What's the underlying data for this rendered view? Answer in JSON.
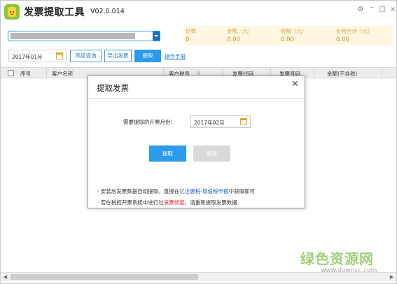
{
  "app": {
    "title": "发票提取工具",
    "version": "V02.0.014",
    "window_controls": [
      "gear-icon",
      "minimize-icon",
      "maximize-icon",
      "close-icon"
    ]
  },
  "toolbar": {
    "date_value": "2017年01月",
    "advanced_query_label": "高级查询",
    "export_label": "导出发票",
    "extract_label": "提取",
    "manual_link": "操作手册"
  },
  "stats": {
    "count_label": "份数",
    "count_value": "0",
    "amount_label": "金额（元）",
    "amount_value": "0.00",
    "tax_label": "税额（元）",
    "tax_value": "0.00",
    "total_label": "价税合计（元）",
    "total_value": "0.00"
  },
  "table": {
    "columns": [
      "序号",
      "客户名称",
      "客户税号",
      "发票代码",
      "发票号码",
      "金额(不含税)"
    ]
  },
  "dialog": {
    "title": "提取发票",
    "field_label": "需要提取的开票月份：",
    "field_value": "2017年02月",
    "ok_label": "提取",
    "cancel_label": "取消",
    "note1_bullet": "·",
    "note1_a": "安装后发票数据自动提取，直接在",
    "note1_link": "亿企惠税-增值税申报",
    "note1_b": "中获取即可",
    "note2_bullet": "·",
    "note2_a": "若在税控开票系统中进行过",
    "note2_link": "发票修复",
    "note2_b": "，请重新提取发票数据"
  },
  "watermark": {
    "cn": "绿色资源网",
    "url": "www.downcc.com"
  },
  "colors": {
    "accent": "#2b9bea",
    "link_blue": "#1e5fc2",
    "warn_red": "#e0262c",
    "stats_bg": "#fff7e1",
    "logo_green": "#8cc63f"
  }
}
